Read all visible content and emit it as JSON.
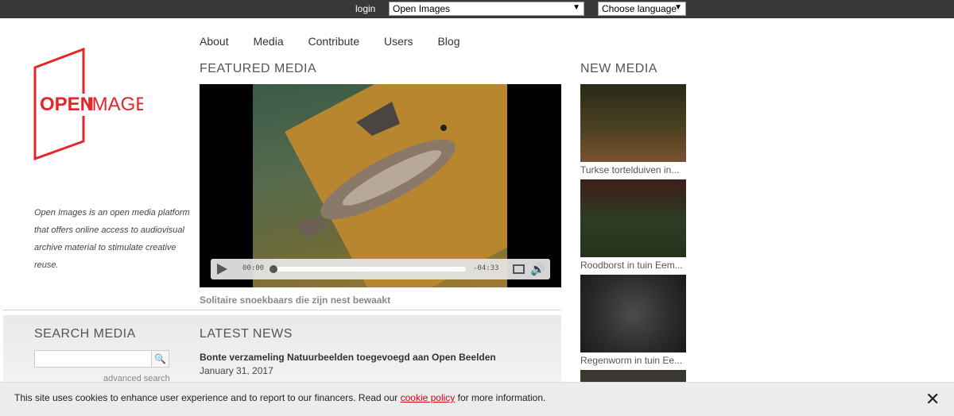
{
  "topbar": {
    "login": "login",
    "site_select": "Open Images",
    "language_select": "Choose language"
  },
  "nav": [
    "About",
    "Media",
    "Contribute",
    "Users",
    "Blog"
  ],
  "logo": {
    "open": "OPEN",
    "images": "IMAGES"
  },
  "description": "Open Images is an open media platform that offers online access to audiovisual archive material to stimulate creative reuse.",
  "featured": {
    "heading": "FEATURED MEDIA",
    "time_current": "00:00",
    "time_remaining": "-04:33",
    "progress": 0,
    "caption": "Solitaire snoekbaars die zijn nest bewaakt"
  },
  "new_media": {
    "heading": "NEW MEDIA",
    "items": [
      "Turkse tortelduiven in...",
      "Roodborst in tuin Eem...",
      "Regenworm in tuin Ee..."
    ]
  },
  "search": {
    "heading": "SEARCH MEDIA",
    "advanced": "advanced search"
  },
  "news": {
    "heading": "LATEST NEWS",
    "title": "Bonte verzameling Natuurbeelden toegevoegd aan Open Beelden",
    "date": "January 31, 2017"
  },
  "cookie": {
    "before": "This site uses cookies to enhance user experience and to report to our financers. Read our ",
    "link": "cookie policy",
    "after": " for more information."
  },
  "colors": {
    "topbar": "#383838",
    "brand": "#e3262b",
    "cookie_link": "#d0021b"
  }
}
